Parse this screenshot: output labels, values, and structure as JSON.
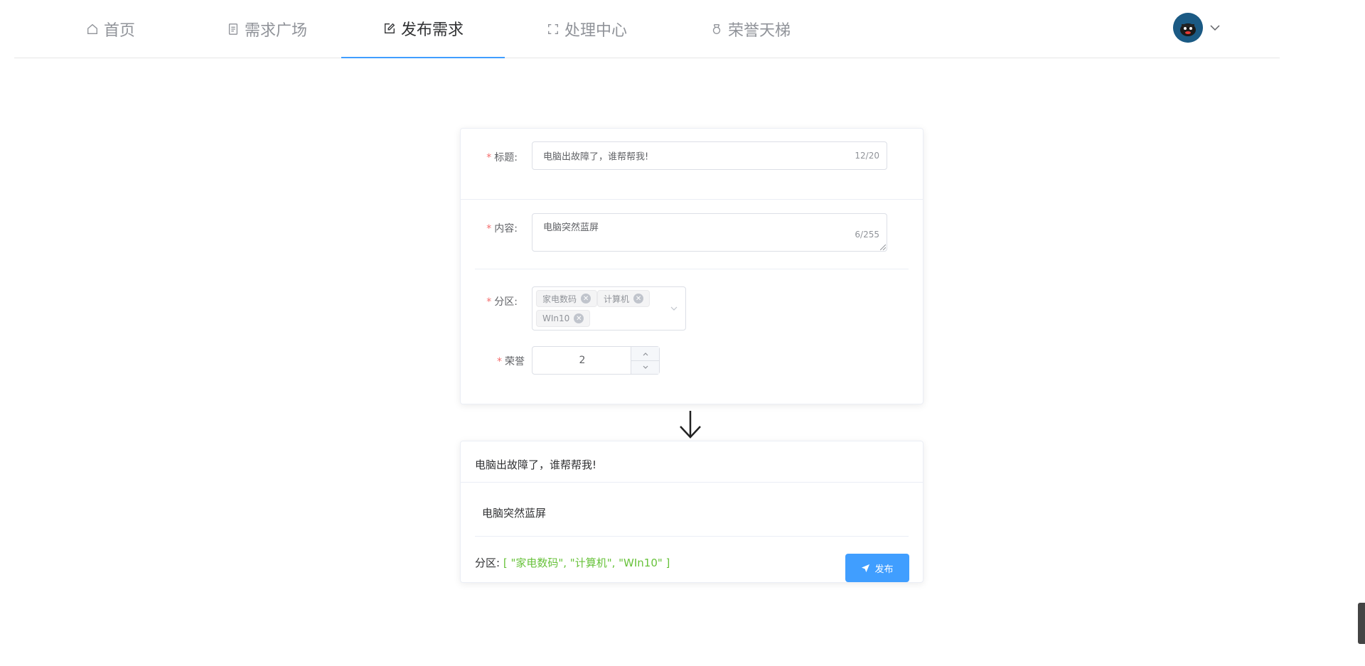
{
  "nav": {
    "items": [
      {
        "label": "首页",
        "icon": "home-icon"
      },
      {
        "label": "需求广场",
        "icon": "document-icon"
      },
      {
        "label": "发布需求",
        "icon": "edit-icon",
        "active": true
      },
      {
        "label": "处理中心",
        "icon": "fullscreen-icon"
      },
      {
        "label": "荣誉天梯",
        "icon": "medal-icon"
      }
    ]
  },
  "form": {
    "title_label": "标题:",
    "title_value": "电脑出故障了，谁帮帮我!",
    "title_counter": "12/20",
    "content_label": "内容:",
    "content_value": "电脑突然蓝屏",
    "content_counter": "6/255",
    "category_label": "分区:",
    "tags": [
      "家电数码",
      "计算机",
      "WIn10"
    ],
    "honor_label": "荣誉",
    "honor_value": "2"
  },
  "preview": {
    "title": "电脑出故障了，谁帮帮我!",
    "content": "电脑突然蓝屏",
    "category_label": "分区:",
    "category_value": "[ \"家电数码\", \"计算机\", \"WIn10\" ]",
    "publish_label": "发布"
  },
  "colors": {
    "accent": "#409eff",
    "required": "#f56c6c",
    "array_text": "#67c23a"
  }
}
